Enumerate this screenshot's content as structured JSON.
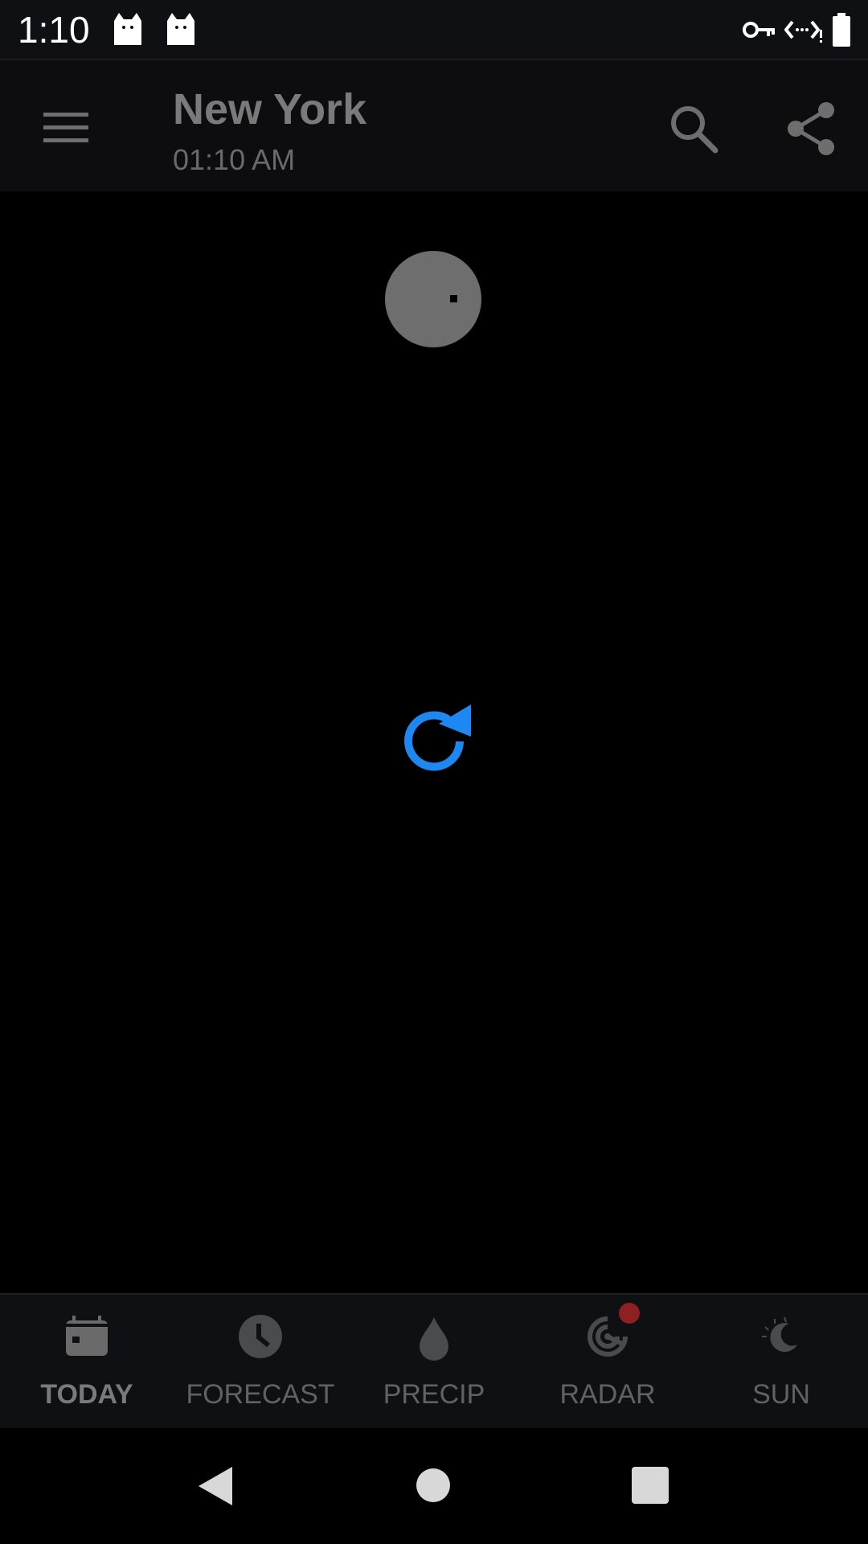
{
  "status_bar": {
    "time": "1:10",
    "icons": [
      "cat-notification-icon",
      "cat-notification-icon",
      "vpn-key-icon",
      "data-saver-icon",
      "battery-icon"
    ]
  },
  "app_bar": {
    "title": "New York",
    "subtitle": "01:10 AM",
    "icons": [
      "menu-icon",
      "search-icon",
      "share-icon"
    ]
  },
  "content": {
    "icons": [
      "weather-placeholder-icon",
      "refresh-icon"
    ],
    "accent_color": "#1e88f2"
  },
  "bottom_nav": {
    "items": [
      {
        "label": "TODAY",
        "icon": "calendar-icon",
        "active": true
      },
      {
        "label": "FORECAST",
        "icon": "clock-icon",
        "active": false
      },
      {
        "label": "PRECIP",
        "icon": "raindrop-icon",
        "active": false
      },
      {
        "label": "RADAR",
        "icon": "radar-icon",
        "active": false
      },
      {
        "label": "SUN",
        "icon": "moon-icon",
        "active": false
      }
    ],
    "badge_color": "#8e1f23"
  },
  "system_nav": {
    "icons": [
      "back-icon",
      "home-icon",
      "recents-icon"
    ]
  }
}
